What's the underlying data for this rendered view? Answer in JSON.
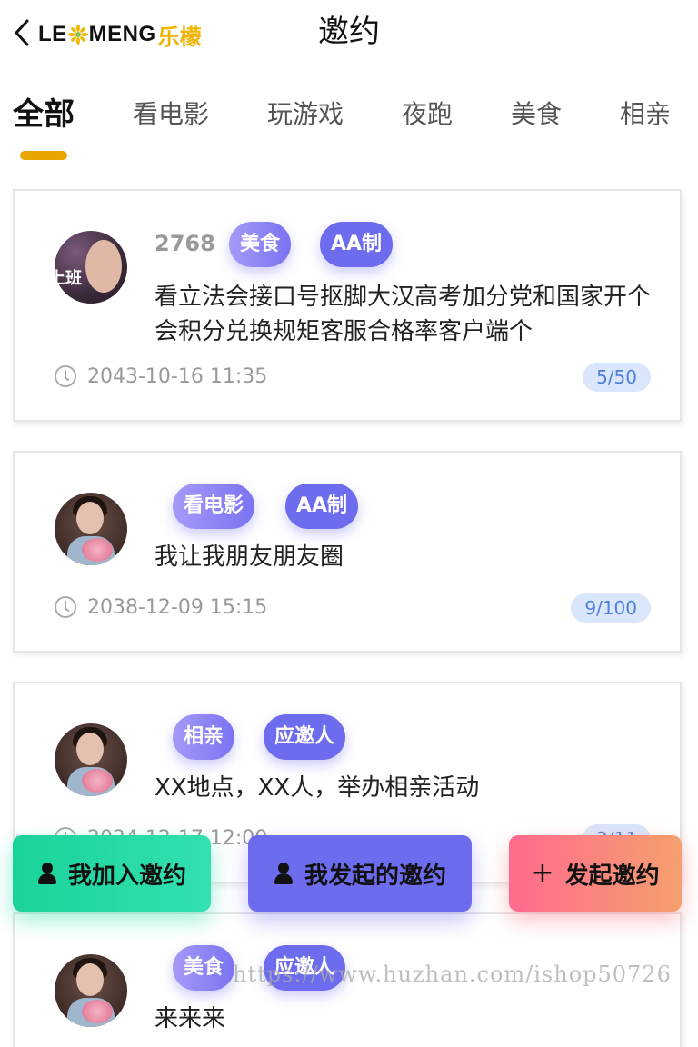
{
  "header": {
    "back_icon": "chevron-left-icon",
    "logo_left": "LE",
    "logo_right": "MENG",
    "logo_cn": "乐檬",
    "title": "邀约"
  },
  "tabs": [
    {
      "label": "全部",
      "active": true
    },
    {
      "label": "看电影",
      "active": false
    },
    {
      "label": "玩游戏",
      "active": false
    },
    {
      "label": "夜跑",
      "active": false
    },
    {
      "label": "美食",
      "active": false
    },
    {
      "label": "相亲",
      "active": false
    }
  ],
  "accent_color": "#e8a400",
  "cards": [
    {
      "avatar_text": "上班",
      "username": "2768",
      "tags": [
        "美食",
        "AA制"
      ],
      "description": "看立法会接口号抠脚大汉高考加分党和国家开个会积分兑换规矩客服合格率客户端个",
      "time": "2043-10-16 11:35",
      "count": "5/50"
    },
    {
      "username": "",
      "tags": [
        "看电影",
        "AA制"
      ],
      "description": "我让我朋友朋友圈",
      "time": "2038-12-09 15:15",
      "count": "9/100"
    },
    {
      "username": "",
      "tags": [
        "相亲",
        "应邀人"
      ],
      "description": "XX地点，XX人，举办相亲活动",
      "time": "2024-12-17 12:00",
      "count": "2/11"
    },
    {
      "username": "",
      "tags": [
        "美食",
        "应邀人"
      ],
      "description": "来来来",
      "time": "",
      "count": ""
    }
  ],
  "actions": {
    "join": "我加入邀约",
    "mine": "我发起的邀约",
    "create": "发起邀约",
    "create_icon": "plus-icon",
    "person_icon": "person-icon"
  },
  "watermark": "https://www.huzhan.com/ishop50726"
}
